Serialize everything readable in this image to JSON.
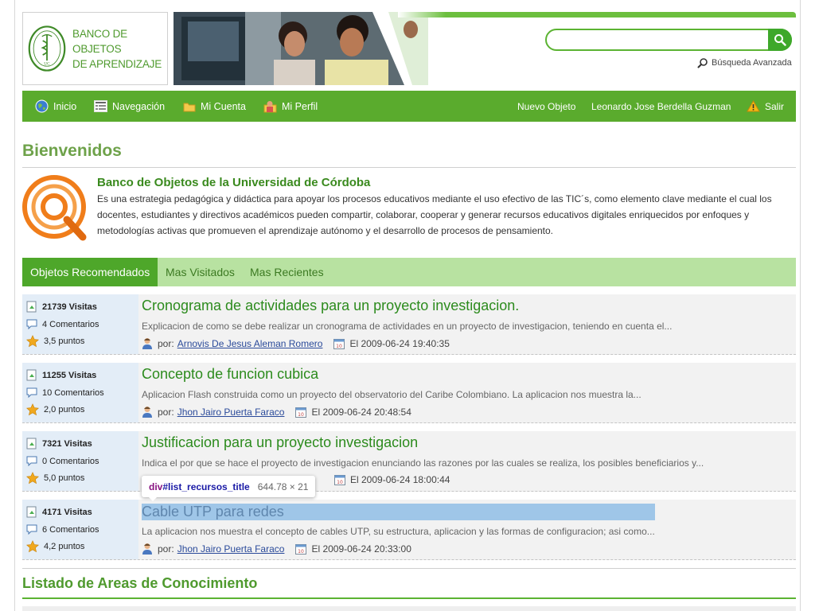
{
  "header": {
    "logo_line1": "BANCO DE OBJETOS",
    "logo_line2": "DE APRENDIZAJE",
    "search_value": "",
    "advanced_search": "Búsqueda Avanzada"
  },
  "nav": {
    "left": [
      "Inicio",
      "Navegación",
      "Mi Cuenta",
      "Mi Perfil"
    ],
    "new_object": "Nuevo Objeto",
    "user_name": "Leonardo Jose Berdella Guzman",
    "logout": "Salir"
  },
  "welcome": {
    "heading": "Bienvenidos",
    "title": "Banco de Objetos de la Universidad de Córdoba",
    "text": "Es una estrategia pedagógica y didáctica para apoyar los procesos educativos mediante el uso efectivo de las TIC´s, como elemento clave mediante el cual los docentes, estudiantes y directivos académicos pueden compartir, colaborar, cooperar  y generar recursos educativos digitales enriquecidos por enfoques y metodologías activas que promueven el aprendizaje autónomo y el desarrollo de procesos de pensamiento."
  },
  "tabs": [
    "Objetos Recomendados",
    "Mas Visitados",
    "Mas Recientes"
  ],
  "items": [
    {
      "visits": "21739 Visitas",
      "comments": "4 Comentarios",
      "points": "3,5 puntos",
      "title": "Cronograma de actividades para un proyecto investigacion.",
      "desc": "Explicacion de como se debe realizar un cronograma de actividades en un proyecto de investigacion, teniendo en cuenta el...",
      "by": "por:",
      "author": "Arnovis De Jesus Aleman Romero",
      "date": "El 2009-06-24 19:40:35"
    },
    {
      "visits": "11255 Visitas",
      "comments": "10 Comentarios",
      "points": "2,0 puntos",
      "title": "Concepto de funcion cubica",
      "desc": "Aplicacion Flash construida como un proyecto del observatorio del Caribe Colombiano. La aplicacion nos muestra la...",
      "by": "por:",
      "author": "Jhon Jairo Puerta Faraco",
      "date": "El 2009-06-24 20:48:54"
    },
    {
      "visits": "7321 Visitas",
      "comments": "0 Comentarios",
      "points": "5,0 puntos",
      "title": "Justificacion para un proyecto investigacion",
      "desc": "Indica el por que se hace el proyecto de investigacion enunciando las razones por las cuales se realiza, los posibles beneficiarios y...",
      "by": "",
      "author": "",
      "date": "El 2009-06-24 18:00:44"
    },
    {
      "visits": "4171 Visitas",
      "comments": "6 Comentarios",
      "points": "4,2 puntos",
      "title": "Cable UTP para redes",
      "desc": "La aplicacion nos muestra el concepto de cables UTP, su estructura, aplicacion y las formas de configuracion; asi como...",
      "by": "por:",
      "author": "Jhon Jairo Puerta Faraco",
      "date": "El 2009-06-24 20:33:00"
    }
  ],
  "inspector": {
    "tag": "div",
    "id": "#list_recursos_title",
    "size": "644.78 × 21"
  },
  "areas_heading": "Listado de Areas de Conocimiento",
  "colors": {
    "brand_green": "#5aab2d",
    "tab_bg": "#b8e2a1",
    "title_green": "#2c8b1d"
  }
}
